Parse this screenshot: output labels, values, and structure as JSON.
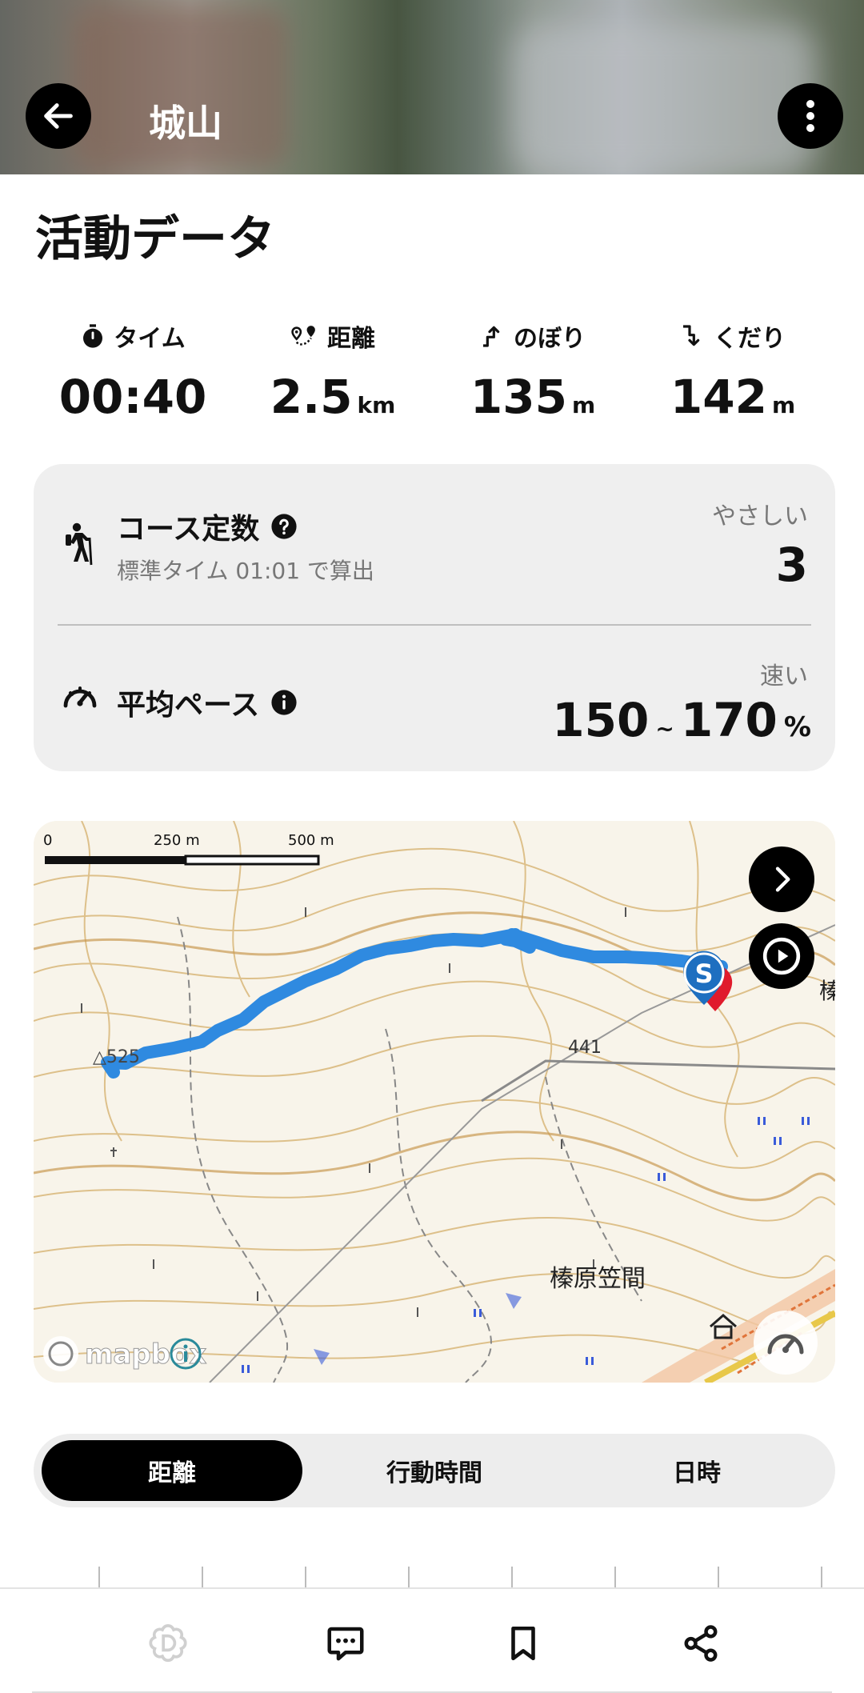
{
  "header": {
    "title": "城山",
    "back_icon": "arrow-left-icon",
    "more_icon": "more-vertical-icon"
  },
  "section": {
    "title": "活動データ"
  },
  "stats": [
    {
      "label": "タイム",
      "icon": "stopwatch-icon",
      "value": "00:40",
      "unit": ""
    },
    {
      "label": "距離",
      "icon": "route-pin-icon",
      "value": "2.5",
      "unit": "km"
    },
    {
      "label": "のぼり",
      "icon": "ascent-arrow-icon",
      "value": "135",
      "unit": "m"
    },
    {
      "label": "くだり",
      "icon": "descent-arrow-icon",
      "value": "142",
      "unit": "m"
    }
  ],
  "course_constant": {
    "title": "コース定数",
    "subtitle": "標準タイム 01:01 で算出",
    "level": "やさしい",
    "value": "3"
  },
  "average_pace": {
    "title": "平均ペース",
    "level": "速い",
    "min": "150",
    "separator": "~",
    "max": "170",
    "unit": "%"
  },
  "map": {
    "scale_labels": [
      "0",
      "250 m",
      "500 m"
    ],
    "elevation_label_1": "△525",
    "elevation_label_2": "441",
    "place_label": "榛原笠間",
    "edge_label": "榛",
    "start_marker": "S",
    "attribution": "mapbox",
    "route_color": "#2f8ae0"
  },
  "tabs": {
    "items": [
      "距離",
      "行動時間",
      "日時"
    ],
    "active_index": 0
  },
  "bottom_nav": {
    "items": [
      "d-logo-icon",
      "comment-icon",
      "bookmark-icon",
      "share-icon"
    ]
  }
}
